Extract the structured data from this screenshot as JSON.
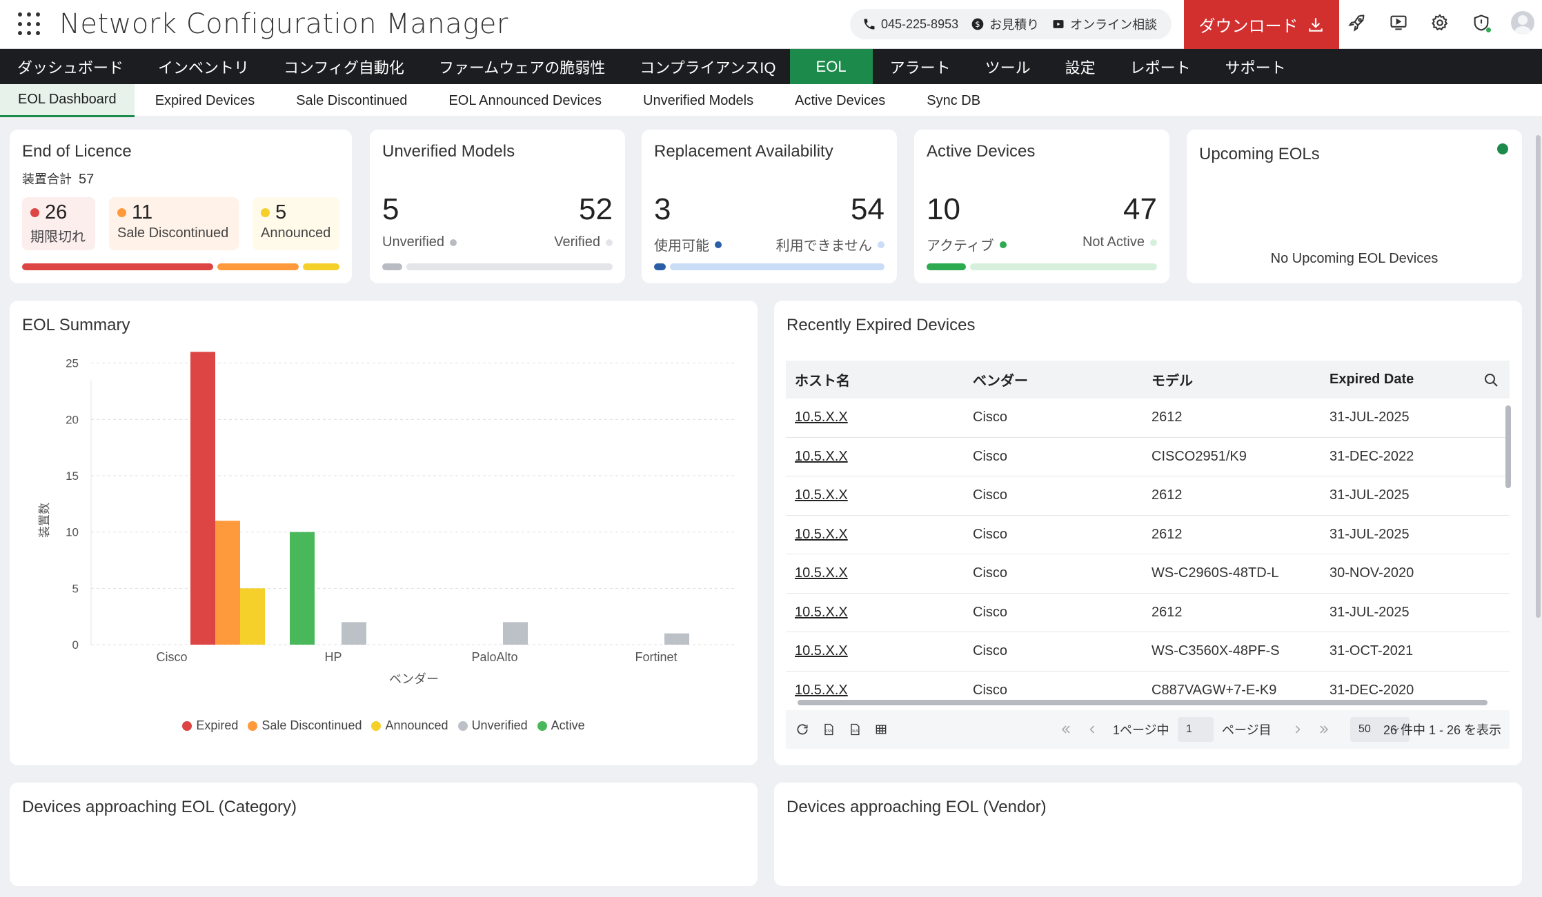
{
  "header": {
    "app_title": "Network Configuration Manager",
    "phone": "045-225-8953",
    "quote": "お見積り",
    "online": "オンライン相談",
    "download": "ダウンロード"
  },
  "nav": [
    {
      "label": "ダッシュボード",
      "active": false
    },
    {
      "label": "インベントリ",
      "active": false
    },
    {
      "label": "コンフィグ自動化",
      "active": false
    },
    {
      "label": "ファームウェアの脆弱性",
      "active": false
    },
    {
      "label": "コンプライアンスIQ",
      "active": false
    },
    {
      "label": "EOL",
      "active": true
    },
    {
      "label": "アラート",
      "active": false
    },
    {
      "label": "ツール",
      "active": false
    },
    {
      "label": "設定",
      "active": false
    },
    {
      "label": "レポート",
      "active": false
    },
    {
      "label": "サポート",
      "active": false
    }
  ],
  "subnav": [
    {
      "label": "EOL Dashboard",
      "active": true
    },
    {
      "label": "Expired Devices",
      "active": false
    },
    {
      "label": "Sale Discontinued",
      "active": false
    },
    {
      "label": "EOL Announced Devices",
      "active": false
    },
    {
      "label": "Unverified Models",
      "active": false
    },
    {
      "label": "Active Devices",
      "active": false
    },
    {
      "label": "Sync DB",
      "active": false
    }
  ],
  "colors": {
    "expired": "#dd4444",
    "sale_discontinued": "#ff9a3c",
    "announced": "#f5cf2a",
    "unverified": "#bcc1c8",
    "active": "#49b85a",
    "blue": "#2a5fa8",
    "light_blue": "#c9ddf7",
    "light_green": "#d6f0dc",
    "light_grey": "#e3e5e8"
  },
  "licence": {
    "title": "End of Licence",
    "total_label": "装置合計",
    "total": "57",
    "expired": {
      "value": "26",
      "label": "期限切れ",
      "fraction": 0.456
    },
    "sale": {
      "value": "11",
      "label": "Sale Discontinued",
      "fraction": 0.193
    },
    "announced": {
      "value": "5",
      "label": "Announced",
      "fraction": 0.088
    }
  },
  "unverified": {
    "title": "Unverified Models",
    "left_value": "5",
    "left_label": "Unverified",
    "right_value": "52",
    "right_label": "Verified",
    "fraction": 0.088
  },
  "replacement": {
    "title": "Replacement Availability",
    "left_value": "3",
    "left_label": "使用可能",
    "right_value": "54",
    "right_label": "利用できません",
    "fraction": 0.053
  },
  "active": {
    "title": "Active Devices",
    "left_value": "10",
    "left_label": "アクティブ",
    "right_value": "47",
    "right_label": "Not Active",
    "fraction": 0.175
  },
  "upcoming": {
    "title": "Upcoming EOLs",
    "empty_text": "No Upcoming EOL Devices"
  },
  "eol_summary": {
    "title": "EOL Summary"
  },
  "chart_data": {
    "type": "bar",
    "title": "EOL Summary",
    "xlabel": "ベンダー",
    "ylabel": "装置数",
    "ylim": [
      0,
      27
    ],
    "yticks": [
      0,
      5,
      10,
      15,
      20,
      25
    ],
    "categories": [
      "Cisco",
      "HP",
      "PaloAlto",
      "Fortinet"
    ],
    "series": [
      {
        "name": "Expired",
        "color": "#dd4444",
        "values": [
          26,
          0,
          0,
          0
        ]
      },
      {
        "name": "Sale Discontinued",
        "color": "#ff9a3c",
        "values": [
          11,
          0,
          0,
          0
        ]
      },
      {
        "name": "Announced",
        "color": "#f5cf2a",
        "values": [
          5,
          0,
          0,
          0
        ]
      },
      {
        "name": "Unverified",
        "color": "#bcc1c8",
        "values": [
          0,
          2,
          2,
          1
        ]
      },
      {
        "name": "Active",
        "color": "#49b85a",
        "values": [
          10,
          0,
          0,
          0
        ]
      }
    ],
    "grid": true,
    "legend": "bottom"
  },
  "recent": {
    "title": "Recently Expired Devices",
    "columns": [
      "ホスト名",
      "ベンダー",
      "モデル",
      "Expired Date"
    ],
    "rows": [
      [
        "10.5.X.X",
        "Cisco",
        "2612",
        "31-JUL-2025"
      ],
      [
        "10.5.X.X",
        "Cisco",
        "CISCO2951/K9",
        "31-DEC-2022"
      ],
      [
        "10.5.X.X",
        "Cisco",
        "2612",
        "31-JUL-2025"
      ],
      [
        "10.5.X.X",
        "Cisco",
        "2612",
        "31-JUL-2025"
      ],
      [
        "10.5.X.X",
        "Cisco",
        "WS-C2960S-48TD-L",
        "30-NOV-2020"
      ],
      [
        "10.5.X.X",
        "Cisco",
        "2612",
        "31-JUL-2025"
      ],
      [
        "10.5.X.X",
        "Cisco",
        "WS-C3560X-48PF-S",
        "31-OCT-2021"
      ],
      [
        "10.5.X.X",
        "Cisco",
        "C887VAGW+7-E-K9",
        "31-DEC-2020"
      ]
    ],
    "pager": {
      "page_of": "1ページ中",
      "page_input": "1",
      "page_suffix": "ページ目",
      "per_page": "50",
      "summary": "26 件中 1 - 26 を表示"
    }
  },
  "approach_category": {
    "title": "Devices approaching EOL (Category)"
  },
  "approach_vendor": {
    "title": "Devices approaching EOL (Vendor)"
  }
}
